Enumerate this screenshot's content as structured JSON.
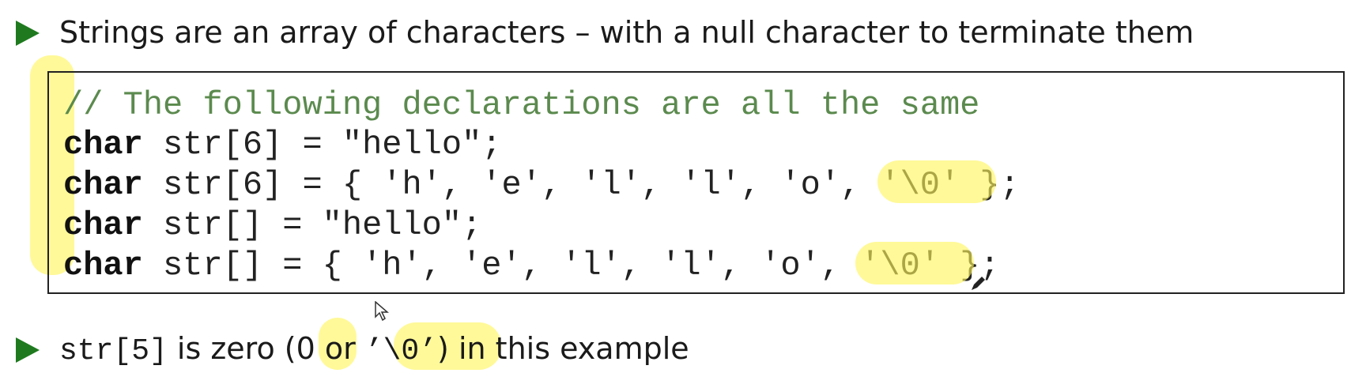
{
  "bullets": [
    {
      "text": "Strings are an array of characters – with a null character to terminate them"
    },
    {
      "code": "str[5]",
      "text_before_zero": " is zero (",
      "zero": "0",
      "or_text": " or ",
      "null_char": "’\\0’",
      "text_after": ") in this example"
    }
  ],
  "code_block": {
    "comment": "// The following declarations are all the same",
    "lines": [
      {
        "keyword": "char",
        "rest": " str[6] = \"hello\";"
      },
      {
        "keyword": "char",
        "rest": " str[6] = { 'h', 'e', 'l', 'l', 'o', '\\0' };"
      },
      {
        "keyword": "char",
        "rest": " str[] = \"hello\";"
      },
      {
        "keyword": "char",
        "rest": " str[] = { 'h', 'e', 'l', 'l', 'o', '\\0' };"
      }
    ]
  },
  "colors": {
    "bullet": "#1f7a1f",
    "comment": "#5b8a4e",
    "highlight": "#fff55a"
  }
}
